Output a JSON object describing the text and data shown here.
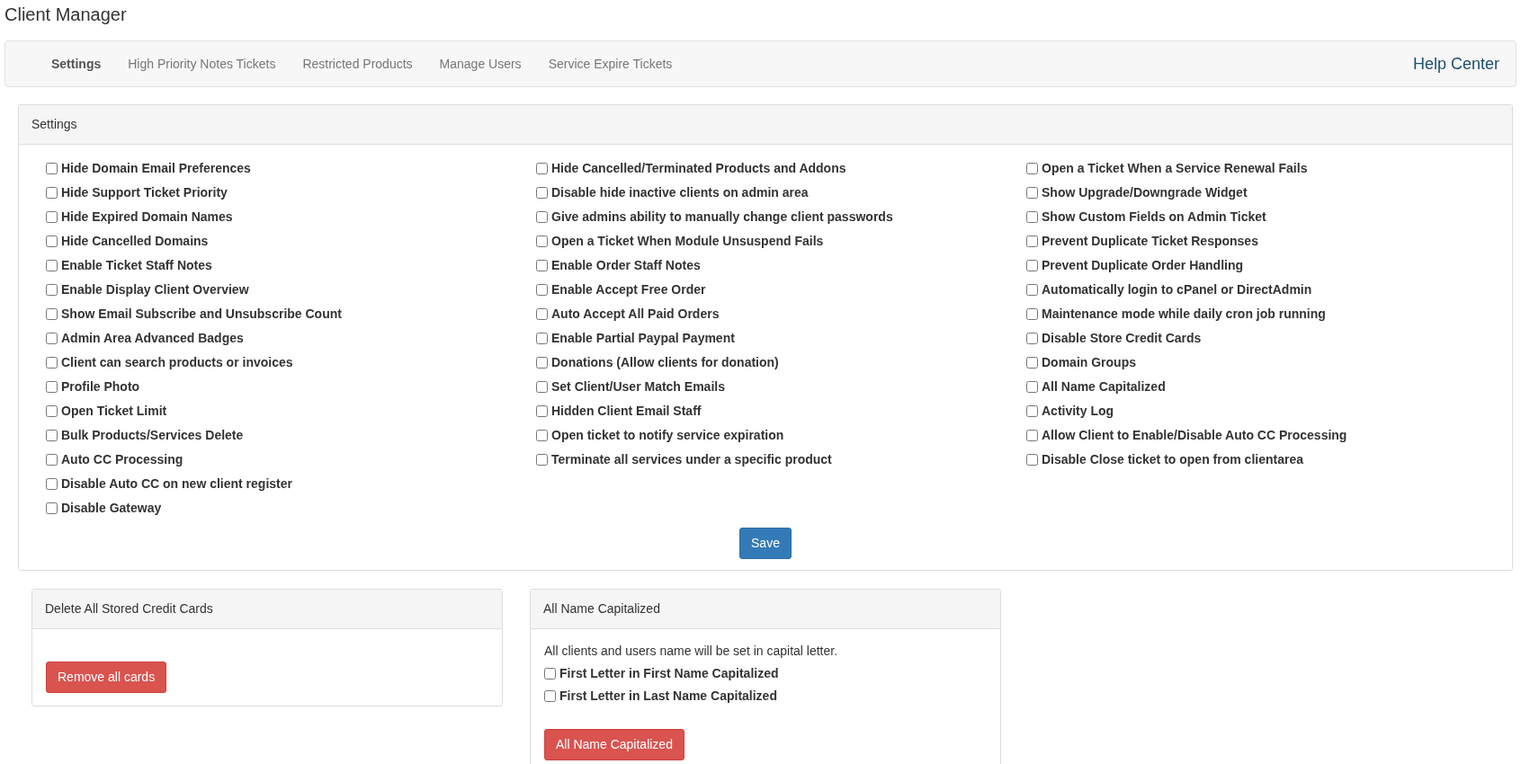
{
  "page_title": "Client Manager",
  "tabs": [
    {
      "label": "Settings",
      "selected": true
    },
    {
      "label": "High Priority Notes Tickets",
      "selected": false
    },
    {
      "label": "Restricted Products",
      "selected": false
    },
    {
      "label": "Manage Users",
      "selected": false
    },
    {
      "label": "Service Expire Tickets",
      "selected": false
    }
  ],
  "help_link": "Help Center",
  "settings": {
    "title": "Settings",
    "columns": [
      [
        {
          "label": "Hide Domain Email Preferences",
          "checked": false
        },
        {
          "label": "Hide Support Ticket Priority",
          "checked": false
        },
        {
          "label": "Hide Expired Domain Names",
          "checked": false
        },
        {
          "label": "Hide Cancelled Domains",
          "checked": false
        },
        {
          "label": "Enable Ticket Staff Notes",
          "checked": false
        },
        {
          "label": "Enable Display Client Overview",
          "checked": false
        },
        {
          "label": "Show Email Subscribe and Unsubscribe Count",
          "checked": false
        },
        {
          "label": "Admin Area Advanced Badges",
          "checked": false
        },
        {
          "label": "Client can search products or invoices",
          "checked": false
        },
        {
          "label": "Profile Photo",
          "checked": false
        },
        {
          "label": "Open Ticket Limit",
          "checked": false
        },
        {
          "label": "Bulk Products/Services Delete",
          "checked": false
        },
        {
          "label": "Auto CC Processing",
          "checked": false
        },
        {
          "label": "Disable Auto CC on new client register",
          "checked": false
        },
        {
          "label": "Disable Gateway",
          "checked": false
        }
      ],
      [
        {
          "label": "Hide Cancelled/Terminated Products and Addons",
          "checked": false
        },
        {
          "label": "Disable hide inactive clients on admin area",
          "checked": false
        },
        {
          "label": "Give admins ability to manually change client passwords",
          "checked": false
        },
        {
          "label": "Open a Ticket When Module Unsuspend Fails",
          "checked": false
        },
        {
          "label": "Enable Order Staff Notes",
          "checked": false
        },
        {
          "label": "Enable Accept Free Order",
          "checked": false
        },
        {
          "label": "Auto Accept All Paid Orders",
          "checked": false
        },
        {
          "label": "Enable Partial Paypal Payment",
          "checked": false
        },
        {
          "label": "Donations (Allow clients for donation)",
          "checked": false
        },
        {
          "label": "Set Client/User Match Emails",
          "checked": false
        },
        {
          "label": "Hidden Client Email Staff",
          "checked": false
        },
        {
          "label": "Open ticket to notify service expiration",
          "checked": false
        },
        {
          "label": "Terminate all services under a specific product",
          "checked": false
        }
      ],
      [
        {
          "label": "Open a Ticket When a Service Renewal Fails",
          "checked": false
        },
        {
          "label": "Show Upgrade/Downgrade Widget",
          "checked": false
        },
        {
          "label": "Show Custom Fields on Admin Ticket",
          "checked": false
        },
        {
          "label": "Prevent Duplicate Ticket Responses",
          "checked": false
        },
        {
          "label": "Prevent Duplicate Order Handling",
          "checked": false
        },
        {
          "label": "Automatically login to cPanel or DirectAdmin",
          "checked": false
        },
        {
          "label": "Maintenance mode while daily cron job running",
          "checked": false
        },
        {
          "label": "Disable Store Credit Cards",
          "checked": false
        },
        {
          "label": "Domain Groups",
          "checked": false
        },
        {
          "label": "All Name Capitalized",
          "checked": false
        },
        {
          "label": "Activity Log",
          "checked": false
        },
        {
          "label": "Allow Client to Enable/Disable Auto CC Processing",
          "checked": false
        },
        {
          "label": "Disable Close ticket to open from clientarea",
          "checked": false
        }
      ]
    ],
    "save_button": "Save"
  },
  "delete_cards": {
    "title": "Delete All Stored Credit Cards",
    "button": "Remove all cards"
  },
  "capitalize": {
    "title": "All Name Capitalized",
    "description": "All clients and users name will be set in capital letter.",
    "options": [
      {
        "label": "First Letter in First Name Capitalized",
        "checked": false
      },
      {
        "label": "First Letter in Last Name Capitalized",
        "checked": false
      }
    ],
    "button": "All Name Capitalized"
  }
}
